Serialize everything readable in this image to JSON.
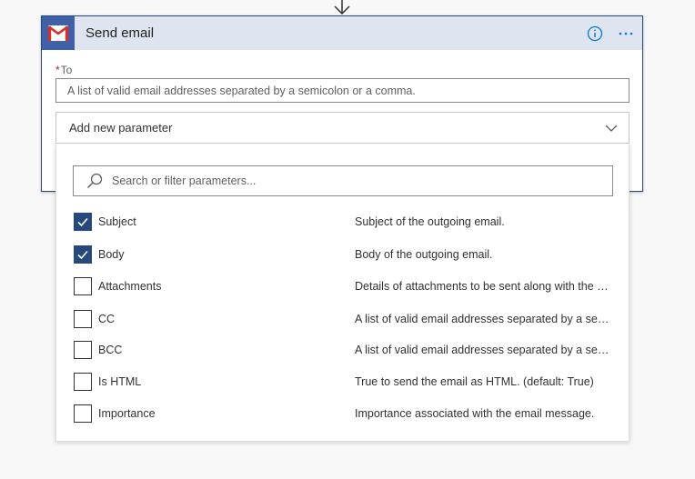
{
  "action": {
    "title": "Send email",
    "logo_icon": "gmail-logo-icon",
    "accent_color": "#25497c",
    "header_color": "#dfe5f0"
  },
  "to_field": {
    "label": "To",
    "required_marker": "*",
    "placeholder": "A list of valid email addresses separated by a semicolon or a comma."
  },
  "add_parameter": {
    "label": "Add new parameter"
  },
  "search": {
    "placeholder": "Search or filter parameters..."
  },
  "parameters": [
    {
      "name": "Subject",
      "description": "Subject of the outgoing email.",
      "checked": true
    },
    {
      "name": "Body",
      "description": "Body of the outgoing email.",
      "checked": true
    },
    {
      "name": "Attachments",
      "description": "Details of attachments to be sent along with the new email.",
      "checked": false
    },
    {
      "name": "CC",
      "description": "A list of valid email addresses separated by a semicolon or a comma.",
      "checked": false
    },
    {
      "name": "BCC",
      "description": "A list of valid email addresses separated by a semicolon or a comma.",
      "checked": false
    },
    {
      "name": "Is HTML",
      "description": "True to send the email as HTML. (default: True)",
      "checked": false
    },
    {
      "name": "Importance",
      "description": "Importance associated with the email message.",
      "checked": false
    }
  ]
}
